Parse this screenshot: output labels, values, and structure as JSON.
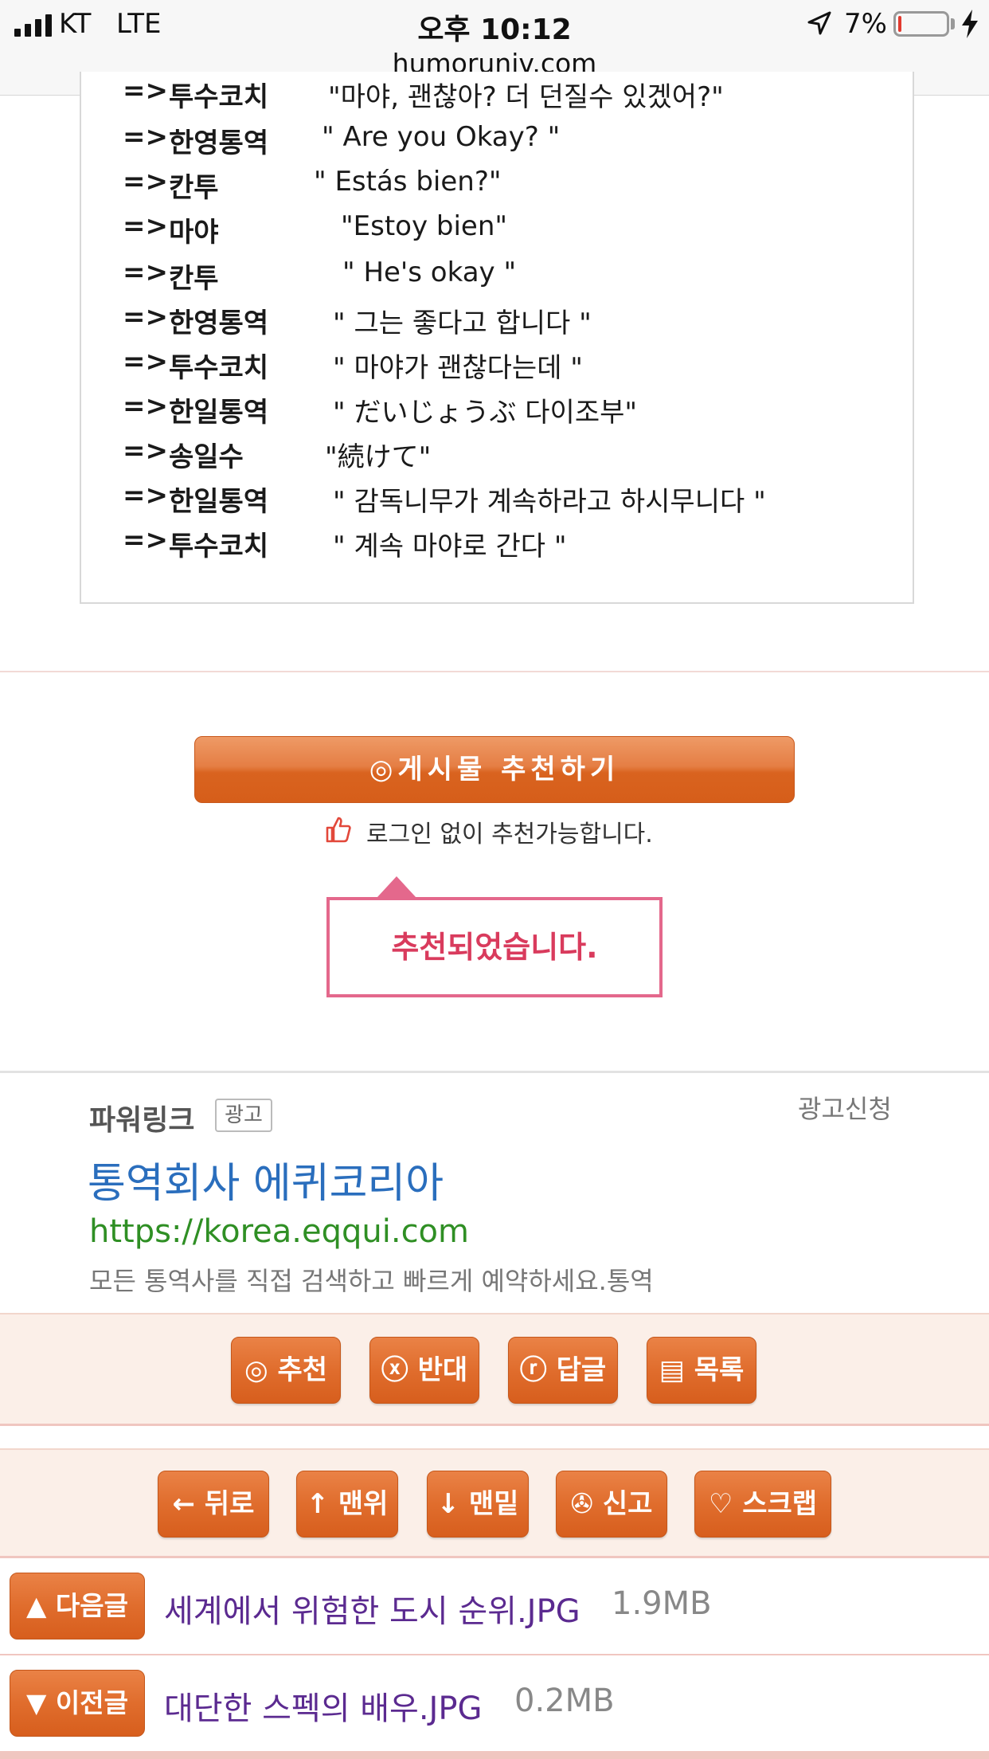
{
  "status_bar": {
    "carrier": "KT",
    "network": "LTE",
    "time": "오후 10:12",
    "battery_percent": "7%",
    "battery_level": 0.07,
    "url": "humoruniv.com"
  },
  "post_image": {
    "arrow": "=>",
    "rows": [
      {
        "speaker": "투수코치",
        "line": "\"마야, 괜찮아? 더 던질수 있겠어?\""
      },
      {
        "speaker": "한영통역",
        "line": "\" Are you Okay? \""
      },
      {
        "speaker": "칸투",
        "line": "\" Estás bien?\""
      },
      {
        "speaker": "마야",
        "line": "\"Estoy bien\""
      },
      {
        "speaker": "칸투",
        "line": "\" He's okay \""
      },
      {
        "speaker": "한영통역",
        "line": "\" 그는 좋다고 합니다 \""
      },
      {
        "speaker": "투수코치",
        "line": "\" 마야가 괜찮다는데 \""
      },
      {
        "speaker": "한일통역",
        "line": "\" だいじょうぶ 다이조부\""
      },
      {
        "speaker": "송일수",
        "line": "\"続けて\""
      },
      {
        "speaker": "한일통역",
        "line": "\" 감독니무가 계속하라고 하시무니다 \""
      },
      {
        "speaker": "투수코치",
        "line": "\" 계속 마야로 간다 \""
      }
    ]
  },
  "recommend": {
    "button_label": "◎게시물  추천하기",
    "note": "로그인 없이 추천가능합니다.",
    "confirmation": "추천되었습니다."
  },
  "ad": {
    "title": "파워링크",
    "badge": "광고",
    "apply": "광고신청",
    "headline": "통역회사 에퀴코리아",
    "url": "https://korea.eqqui.com",
    "description": "모든 통역사를 직접 검색하고 빠르게 예약하세요.통역"
  },
  "actions_primary": {
    "recommend": "◎ 추천",
    "oppose": "ⓧ 반대",
    "reply": "ⓡ 답글",
    "list": "▤ 목록"
  },
  "actions_secondary": {
    "back": "← 뒤로",
    "top": "↑ 맨위",
    "bottom": "↓ 맨밑",
    "report": "✇ 신고",
    "scrap": "♡ 스크랩"
  },
  "post_nav": {
    "next_label": "▲ 다음글",
    "next_title": "세계에서 위험한 도시 순위.JPG",
    "next_size": "1.9MB",
    "prev_label": "▼ 이전글",
    "prev_title": "대단한 스펙의 배우.JPG",
    "prev_size": "0.2MB"
  },
  "colors": {
    "accent_orange": "#e06d2d",
    "confirm_pink": "#e4688c",
    "ad_link_blue": "#2a6ebd",
    "ad_url_green": "#2f8f24",
    "nav_title_purple": "#5b2a90"
  }
}
